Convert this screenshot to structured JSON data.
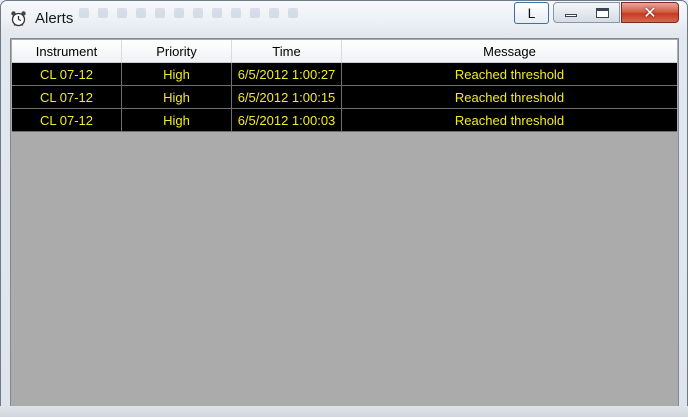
{
  "window": {
    "title": "Alerts",
    "app_icon": "alarm-clock-icon",
    "extra_button_label": "L",
    "caption_buttons": [
      "minimize-icon",
      "maximize-icon",
      "close-icon"
    ]
  },
  "grid": {
    "columns": [
      "Instrument",
      "Priority",
      "Time",
      "Message"
    ],
    "rows": [
      [
        "CL 07-12",
        "High",
        "6/5/2012 1:00:27",
        "Reached threshold"
      ],
      [
        "CL 07-12",
        "High",
        "6/5/2012 1:00:15",
        "Reached threshold"
      ],
      [
        "CL 07-12",
        "High",
        "6/5/2012 1:00:03",
        "Reached threshold"
      ]
    ],
    "row_background": "#000000",
    "row_text_color": "#f3ea2a",
    "empty_area_color": "#ababab"
  }
}
